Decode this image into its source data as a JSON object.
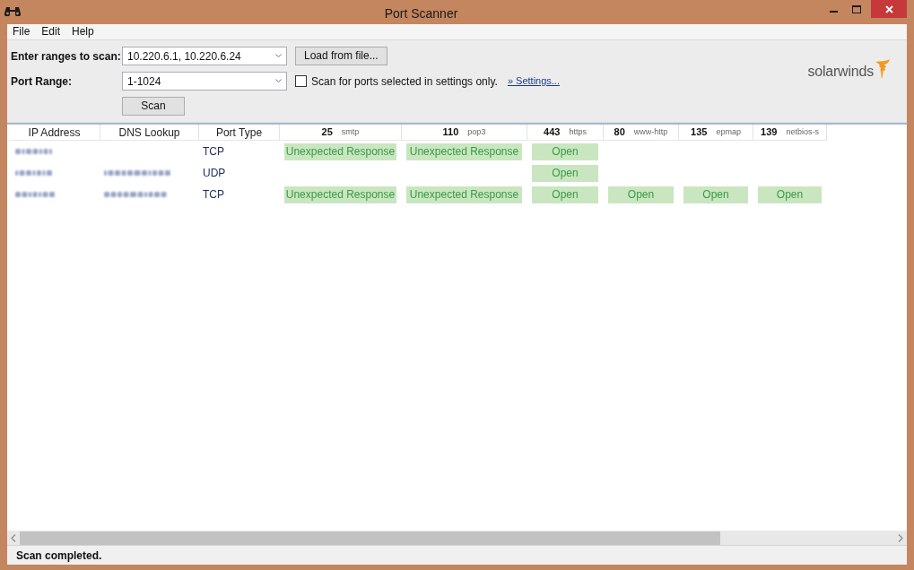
{
  "window": {
    "title": "Port Scanner"
  },
  "menu": [
    "File",
    "Edit",
    "Help"
  ],
  "form": {
    "ranges_label": "Enter ranges to scan:",
    "ranges_value": "10.220.6.1, 10.220.6.24",
    "port_label": "Port Range:",
    "port_value": "1-1024",
    "load_button": "Load from file...",
    "scan_button": "Scan",
    "settings_only": {
      "label": "Scan for ports selected in settings only.",
      "checked": false
    },
    "settings_link": "» Settings..."
  },
  "logo": {
    "text": "solarwinds"
  },
  "table": {
    "columns": [
      {
        "kind": "text",
        "label": "IP Address"
      },
      {
        "kind": "text",
        "label": "DNS Lookup"
      },
      {
        "kind": "text",
        "label": "Port Type"
      },
      {
        "kind": "port",
        "port": "25",
        "service": "smtp"
      },
      {
        "kind": "port",
        "port": "110",
        "service": "pop3"
      },
      {
        "kind": "port",
        "port": "443",
        "service": "https"
      },
      {
        "kind": "port",
        "port": "80",
        "service": "www-http"
      },
      {
        "kind": "port",
        "port": "135",
        "service": "epmap"
      },
      {
        "kind": "port",
        "port": "139",
        "service": "netbios-s"
      }
    ],
    "rows": [
      {
        "ip_blurred": true,
        "dns_blurred": false,
        "port_type": "TCP",
        "ports": [
          {
            "kind": "result",
            "text": "Unexpected Response"
          },
          {
            "kind": "result",
            "text": "Unexpected Response"
          },
          {
            "kind": "result",
            "text": "Open"
          },
          {
            "kind": "empty"
          },
          {
            "kind": "empty"
          },
          {
            "kind": "empty"
          }
        ]
      },
      {
        "ip_blurred": true,
        "dns_blurred": true,
        "port_type": "UDP",
        "ports": [
          {
            "kind": "empty"
          },
          {
            "kind": "empty"
          },
          {
            "kind": "result",
            "text": "Open"
          },
          {
            "kind": "empty"
          },
          {
            "kind": "empty"
          },
          {
            "kind": "empty"
          }
        ]
      },
      {
        "ip_blurred": true,
        "dns_blurred": true,
        "port_type": "TCP",
        "ports": [
          {
            "kind": "result",
            "text": "Unexpected Response"
          },
          {
            "kind": "result",
            "text": "Unexpected Response"
          },
          {
            "kind": "result",
            "text": "Open"
          },
          {
            "kind": "result",
            "text": "Open"
          },
          {
            "kind": "result",
            "text": "Open"
          },
          {
            "kind": "result",
            "text": "Open"
          }
        ]
      }
    ]
  },
  "status_bar": {
    "text": "Scan completed."
  }
}
